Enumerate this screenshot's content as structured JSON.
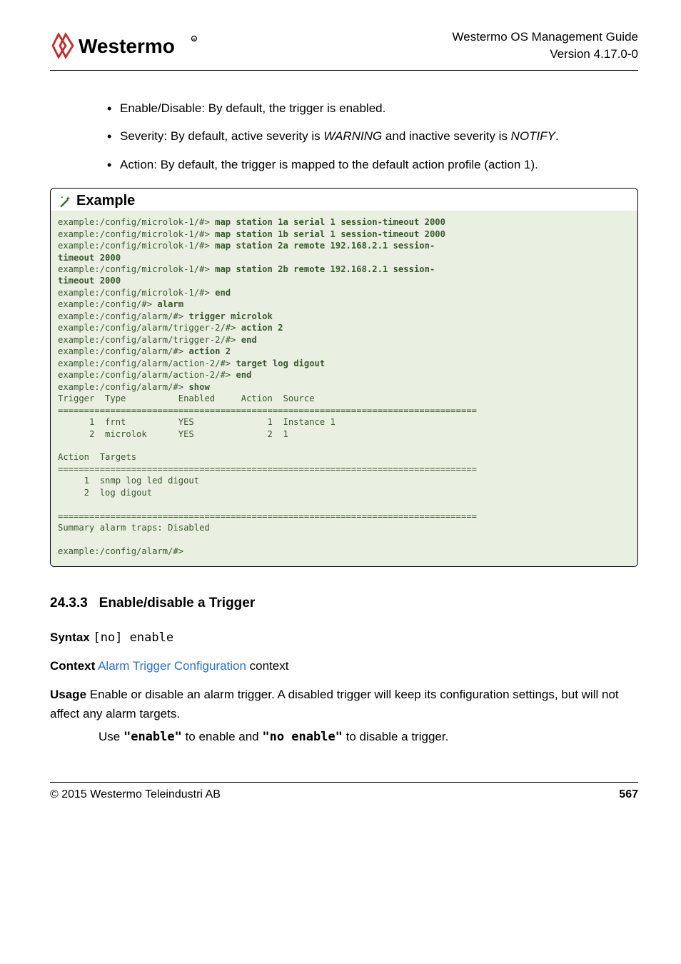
{
  "header": {
    "title_line1": "Westermo OS Management Guide",
    "title_line2": "Version 4.17.0-0"
  },
  "bullets": [
    {
      "label": "Enable/Disable:",
      "text": " By default, the trigger is enabled."
    },
    {
      "label": "Severity:",
      "text_before": " By default, active severity is ",
      "em1": "WARNING",
      "mid": " and inactive severity is ",
      "em2": "NOTIFY",
      "after": "."
    },
    {
      "label": "Action:",
      "text": " By default, the trigger is mapped to the default action profile (action 1)."
    }
  ],
  "example": {
    "heading": "Example",
    "lines": [
      {
        "p": "example:/config/microlok-1/#> ",
        "c": "map station 1a serial 1 session-timeout 2000"
      },
      {
        "p": "example:/config/microlok-1/#> ",
        "c": "map station 1b serial 1 session-timeout 2000"
      },
      {
        "p": "example:/config/microlok-1/#> ",
        "c": "map station 2a remote 192.168.2.1 session-"
      },
      {
        "p": "",
        "c": "timeout 2000"
      },
      {
        "p": "example:/config/microlok-1/#> ",
        "c": "map station 2b remote 192.168.2.1 session-"
      },
      {
        "p": "",
        "c": "timeout 2000"
      },
      {
        "p": "example:/config/microlok-1/#> ",
        "c": "end"
      },
      {
        "p": "example:/config/#> ",
        "c": "alarm"
      },
      {
        "p": "example:/config/alarm/#> ",
        "c": "trigger microlok"
      },
      {
        "p": "example:/config/alarm/trigger-2/#> ",
        "c": "action 2"
      },
      {
        "p": "example:/config/alarm/trigger-2/#> ",
        "c": "end"
      },
      {
        "p": "example:/config/alarm/#> ",
        "c": "action 2"
      },
      {
        "p": "example:/config/alarm/action-2/#> ",
        "c": "target log digout"
      },
      {
        "p": "example:/config/alarm/action-2/#> ",
        "c": "end"
      },
      {
        "p": "example:/config/alarm/#> ",
        "c": "show"
      }
    ],
    "out1_header": "Trigger  Type          Enabled     Action  Source",
    "out1_sep": "================================================================================",
    "out1_r1": "      1  frnt          YES              1  Instance 1",
    "out1_r2": "      2  microlok      YES              2  1",
    "out1_blank": "",
    "out2_header": "Action  Targets",
    "out2_sep": "================================================================================",
    "out2_r1": "     1  snmp log led digout",
    "out2_r2": "     2  log digout",
    "out3_sep": "================================================================================",
    "out3_sum": "Summary alarm traps: Disabled",
    "out3_blank": "",
    "out3_prompt": "example:/config/alarm/#>"
  },
  "section": {
    "number": "24.3.3",
    "title": "Enable/disable a Trigger"
  },
  "defs": {
    "syntax_label": "Syntax",
    "syntax_value": "[no] enable",
    "context_label": "Context",
    "context_link": "Alarm Trigger Configuration",
    "context_after": " context",
    "usage_label": "Usage",
    "usage_text1": "Enable or disable an alarm trigger. A disabled trigger will keep its configuration settings, but will not affect any alarm targets.",
    "usage_text2_a": "Use ",
    "usage_cmd1": "\"enable\"",
    "usage_text2_b": " to enable and ",
    "usage_cmd2": "\"no enable\"",
    "usage_text2_c": " to disable a trigger."
  },
  "footer": {
    "left": "© 2015 Westermo Teleindustri AB",
    "right": "567"
  }
}
